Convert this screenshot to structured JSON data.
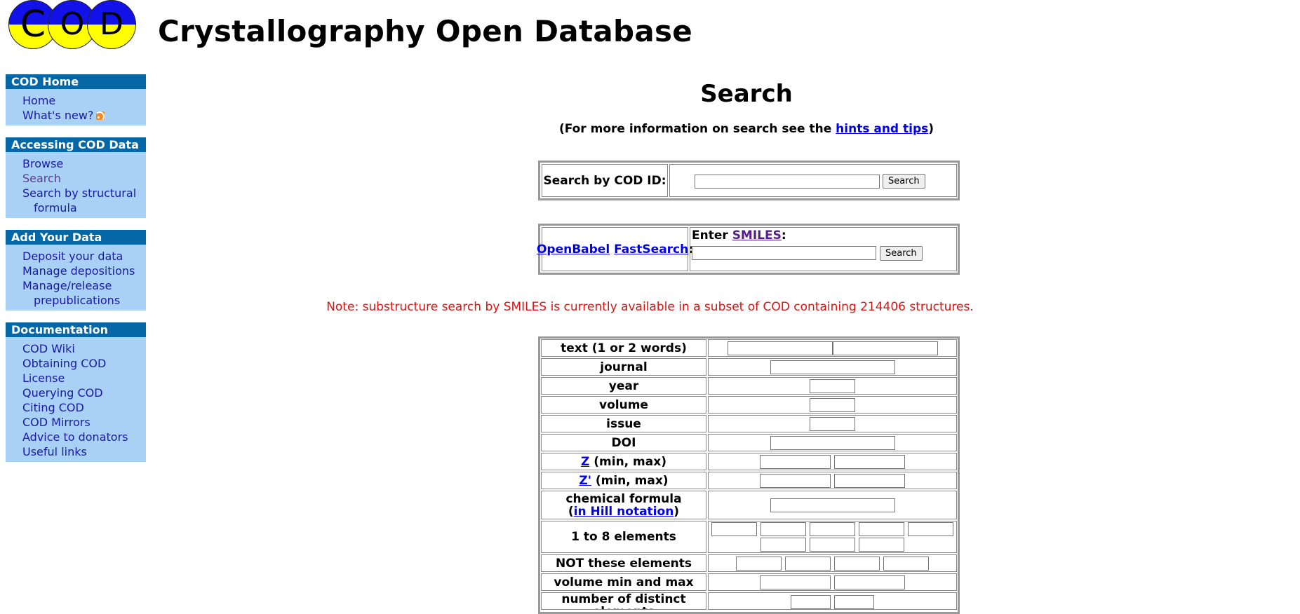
{
  "header": {
    "logo_letters": [
      "C",
      "O",
      "D"
    ],
    "site_title": "Crystallography Open Database"
  },
  "sidebar": {
    "sections": [
      {
        "title": "COD Home",
        "items": [
          "Home",
          "What's new?"
        ]
      },
      {
        "title": "Accessing COD Data",
        "items": [
          "Browse",
          "Search",
          "Search by structural",
          "formula"
        ]
      },
      {
        "title": "Add Your Data",
        "items": [
          "Deposit your data",
          "Manage depositions",
          "Manage/release",
          "prepublications"
        ]
      },
      {
        "title": "Documentation",
        "items": [
          "COD Wiki",
          "Obtaining COD",
          "License",
          "Querying COD",
          "Citing COD",
          "COD Mirrors",
          "Advice to donators",
          "Useful links"
        ]
      }
    ]
  },
  "main": {
    "title": "Search",
    "hint_prefix": "(For more information on search see the ",
    "hint_link": "hints and tips",
    "hint_suffix": ")",
    "cod_id": {
      "label": "Search by COD ID:",
      "value": "",
      "button": "Search"
    },
    "smiles": {
      "link_openbabel": "OpenBabel",
      "link_fastsearch": "FastSearch",
      "colon": ":",
      "enter_prefix": "Enter ",
      "enter_link": "SMILES",
      "enter_suffix": ":",
      "value": "",
      "button": "Search"
    },
    "note": "Note: substructure search by SMILES is currently available in a subset of COD containing 214406 structures.",
    "criteria": {
      "text": "text (1 or 2 words)",
      "journal": "journal",
      "year": "year",
      "volume": "volume",
      "issue": "issue",
      "doi": "DOI",
      "z_link": "Z",
      "z_suffix": " (min, max)",
      "zprime_link": "Z'",
      "zprime_suffix": " (min, max)",
      "formula_line1": "chemical formula",
      "formula_open": "(",
      "formula_link": "in Hill notation",
      "formula_close": ")",
      "elements": "1 to 8 elements",
      "not_elements": "NOT these elements",
      "volume_minmax": "volume min and max",
      "distinct": "number of distinct elements"
    }
  }
}
